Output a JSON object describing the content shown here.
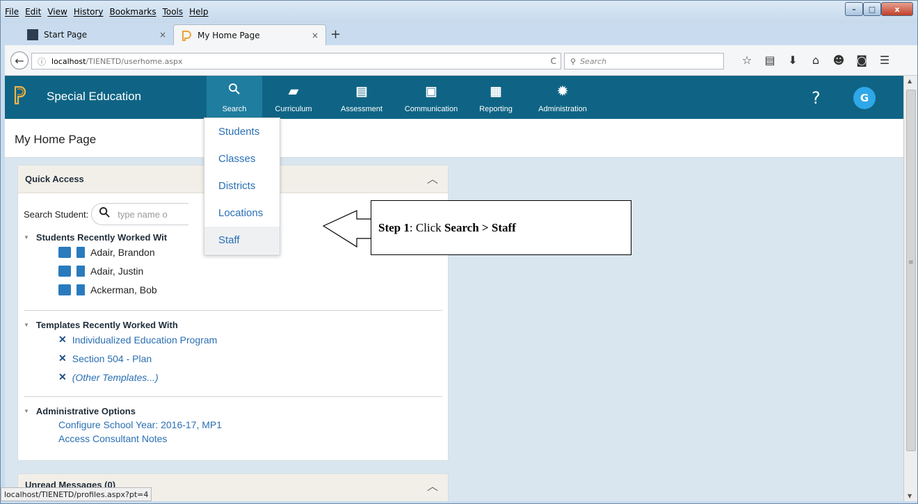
{
  "window": {
    "menu": [
      "File",
      "Edit",
      "View",
      "History",
      "Bookmarks",
      "Tools",
      "Help"
    ],
    "controls": {
      "minimize": "–",
      "maximize": "□",
      "close": "x"
    }
  },
  "tabs": [
    {
      "label": "Start Page",
      "close": "×"
    },
    {
      "label": "My Home Page",
      "close": "×"
    }
  ],
  "new_tab": "+",
  "navbar": {
    "back": "←",
    "info": "ⓘ",
    "url_host": "localhost",
    "url_path": "/TIENETD/userhome.aspx",
    "reload": "C",
    "search_placeholder": "Search",
    "search_icon": "search-icon"
  },
  "app": {
    "name": "Special Education",
    "nav": [
      {
        "label": "Search",
        "icon": "search-icon",
        "glyph": "⚲"
      },
      {
        "label": "Curriculum",
        "icon": "book-icon",
        "glyph": "▰"
      },
      {
        "label": "Assessment",
        "icon": "clipboard-icon",
        "glyph": "▤"
      },
      {
        "label": "Communication",
        "icon": "message-icon",
        "glyph": "▣"
      },
      {
        "label": "Reporting",
        "icon": "report-icon",
        "glyph": "▦"
      },
      {
        "label": "Administration",
        "icon": "gear-icon",
        "glyph": "✹"
      }
    ],
    "help": "?",
    "avatar": "G",
    "header_color": "#0f6485"
  },
  "page": {
    "title": "My Home Page"
  },
  "dropdown": [
    "Students",
    "Classes",
    "Districts",
    "Locations",
    "Staff"
  ],
  "quick_access": {
    "title": "Quick Access",
    "search_label": "Search Student:",
    "search_placeholder": "type name o",
    "students_header": "Students Recently Worked Wit",
    "students": [
      "Adair, Brandon",
      "Adair, Justin",
      "Ackerman, Bob"
    ],
    "templates_header": "Templates Recently Worked With",
    "templates": [
      "Individualized Education Program",
      "Section 504 - Plan",
      "(Other Templates...)"
    ],
    "admin_header": "Administrative Options",
    "admin_links": [
      "Configure School Year: 2016-17, MP1",
      "Access Consultant Notes"
    ]
  },
  "messages_card": {
    "title": "Unread Messages (0)"
  },
  "annotation": {
    "step": "Step 1",
    "text_mid": ": Click ",
    "target": "Search > Staff"
  },
  "status_url": "localhost/TIENETD/profiles.aspx?pt=4"
}
